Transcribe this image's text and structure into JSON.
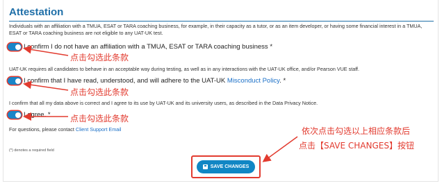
{
  "section": {
    "title": "Attestation",
    "intro": "Individuals with an affiliation with a TMUA, ESAT or TARA coaching business, for example, in their capacity as a tutor, or as an item developer, or having some financial interest in a TMUA, ESAT or TARA coaching business are not eligible to any UAT-UK test.",
    "behavior_text": "UAT-UK requires all candidates to behave in an acceptable way during testing, as well as in any interactions with the UAT-UK office, and/or Pearson VUE staff.",
    "confirm_text": "I confirm that all my data above is correct and I agree to its use by UAT-UK and its university users, as described in the Data Privacy Notice.",
    "contact_prefix": "For questions, please contact ",
    "contact_link": "Client Support Email",
    "required_note": "(*) denotes a required field"
  },
  "checkboxes": [
    {
      "label": "I confirm I do not have an affiliation with a TMUA, ESAT or TARA coaching business *",
      "checked": true
    },
    {
      "label": "I confirm that I have read, understood, and will adhere to the UAT-UK ",
      "link": "Misconduct Policy",
      "suffix": ". *",
      "checked": true
    },
    {
      "label": "I agree. *",
      "checked": true
    }
  ],
  "annotations": {
    "click1": "点击勾选此条款",
    "click2": "点击勾选此条款",
    "click3": "点击勾选此条款",
    "instruction_line1": "依次点击勾选以上相应条款后",
    "instruction_line2": "点击【SAVE CHANGES】按钮"
  },
  "actions": {
    "save_label": "SAVE CHANGES"
  },
  "colors": {
    "accent": "#1186c4",
    "title": "#1f6fa8",
    "annotation": "#e23b2f",
    "link": "#1a6fc7"
  }
}
